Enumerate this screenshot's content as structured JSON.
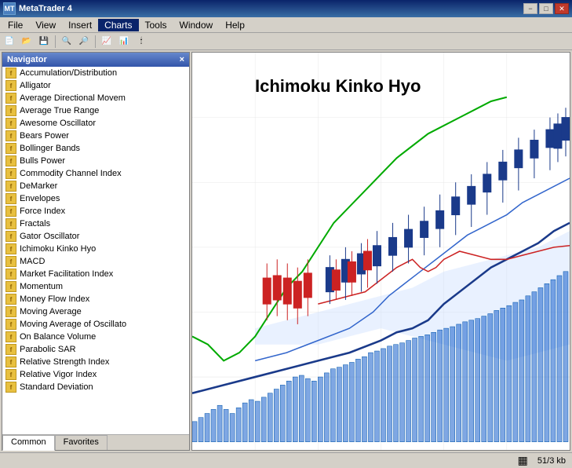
{
  "window": {
    "title": "MetaTrader 4",
    "icon": "MT4",
    "min_btn": "−",
    "max_btn": "□",
    "close_btn": "✕"
  },
  "menubar": {
    "items": [
      "File",
      "View",
      "Insert",
      "Charts",
      "Tools",
      "Window",
      "Help"
    ]
  },
  "navigator": {
    "title": "Navigator",
    "close": "×",
    "indicators": [
      "Accumulation/Distribution",
      "Alligator",
      "Average Directional Movem",
      "Average True Range",
      "Awesome Oscillator",
      "Bears Power",
      "Bollinger Bands",
      "Bulls Power",
      "Commodity Channel Index",
      "DeMarker",
      "Envelopes",
      "Force Index",
      "Fractals",
      "Gator Oscillator",
      "Ichimoku Kinko Hyo",
      "MACD",
      "Market Facilitation Index",
      "Momentum",
      "Money Flow Index",
      "Moving Average",
      "Moving Average of Oscillato",
      "On Balance Volume",
      "Parabolic SAR",
      "Relative Strength Index",
      "Relative Vigor Index",
      "Standard Deviation"
    ],
    "tabs": [
      "Common",
      "Favorites"
    ]
  },
  "chart": {
    "title": "Ichimoku Kinko Hyo"
  },
  "statusbar": {
    "grid_icon": "▦",
    "info": "51/3 kb"
  }
}
